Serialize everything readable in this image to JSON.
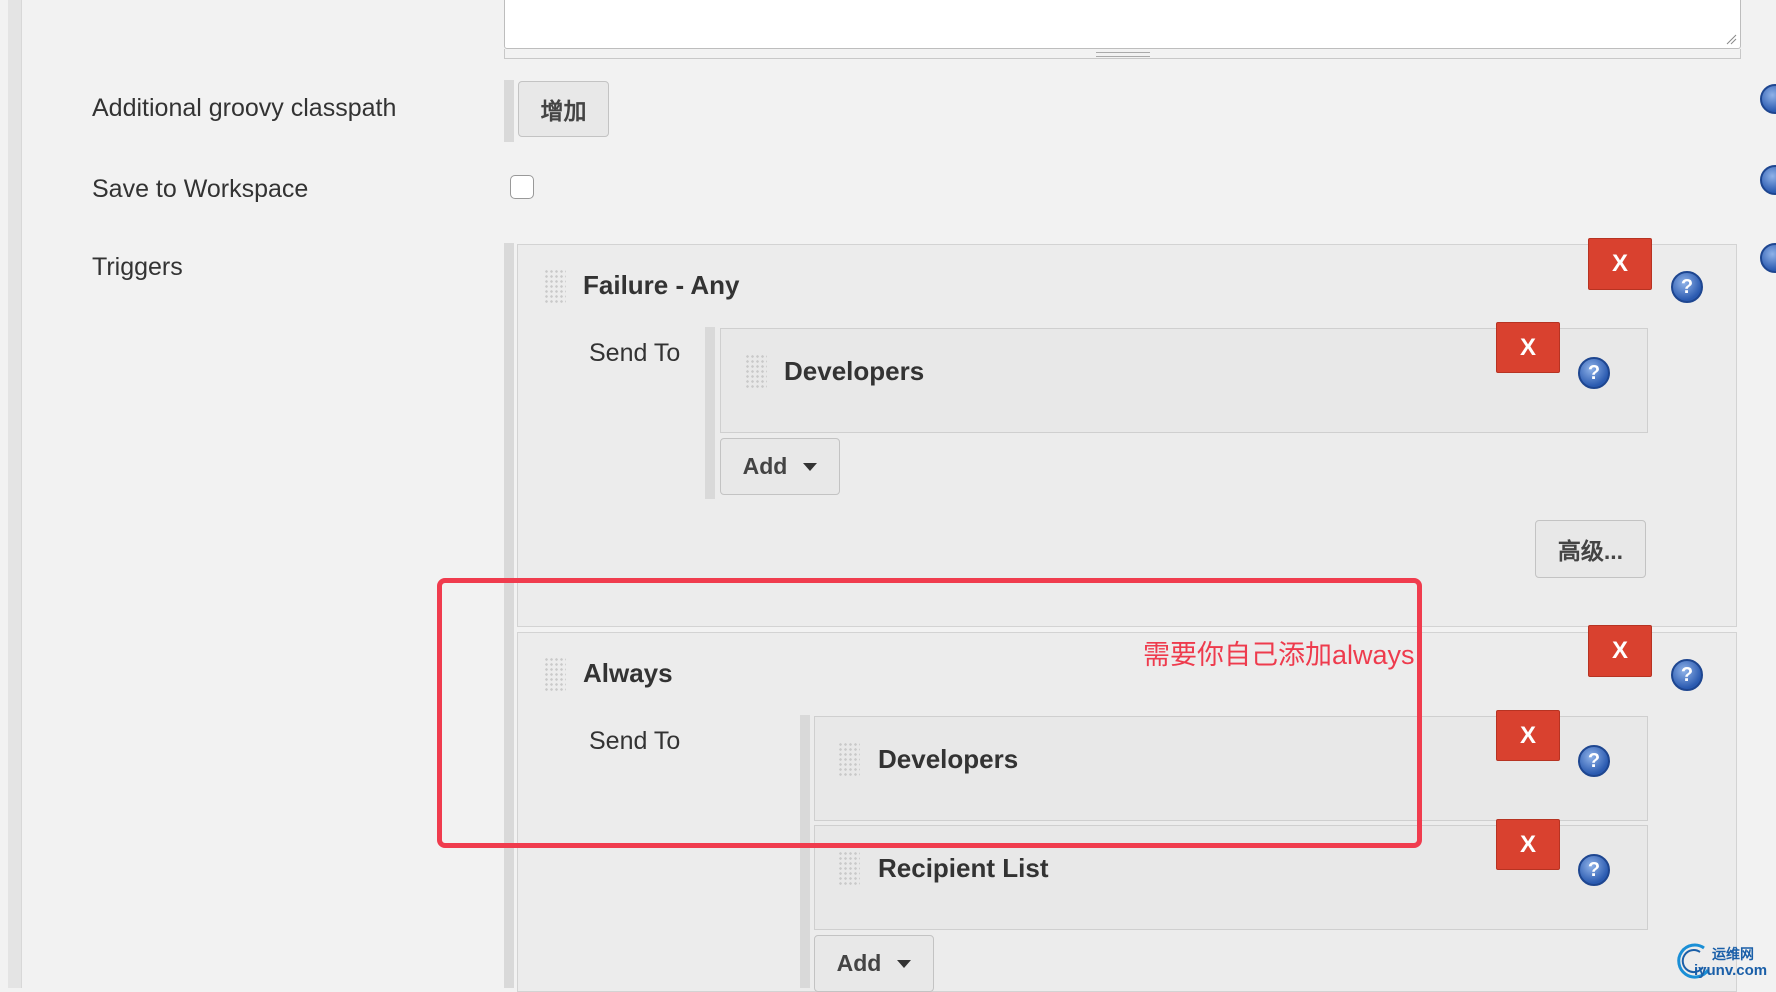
{
  "form": {
    "groovy_classpath_label": "Additional groovy classpath",
    "groovy_add_button": "增加",
    "save_workspace_label": "Save to Workspace",
    "triggers_label": "Triggers"
  },
  "triggers": [
    {
      "title": "Failure - Any",
      "send_to_label": "Send To",
      "recipients": [
        "Developers"
      ],
      "add_button": "Add",
      "advanced_button": "高级...",
      "delete_label": "X"
    },
    {
      "title": "Always",
      "send_to_label": "Send To",
      "recipients": [
        "Developers",
        "Recipient List"
      ],
      "add_button": "Add",
      "delete_label": "X"
    }
  ],
  "icons": {
    "help": "?",
    "delete": "X"
  },
  "annotation": {
    "note": "需要你自己添加always",
    "color": "#f03c4e"
  },
  "watermark": {
    "cn": "运维网",
    "url": "iyunv.com"
  },
  "colors": {
    "delete_red": "#d9412f",
    "help_blue": "#2a5ab0",
    "background": "#f2f2f2"
  }
}
